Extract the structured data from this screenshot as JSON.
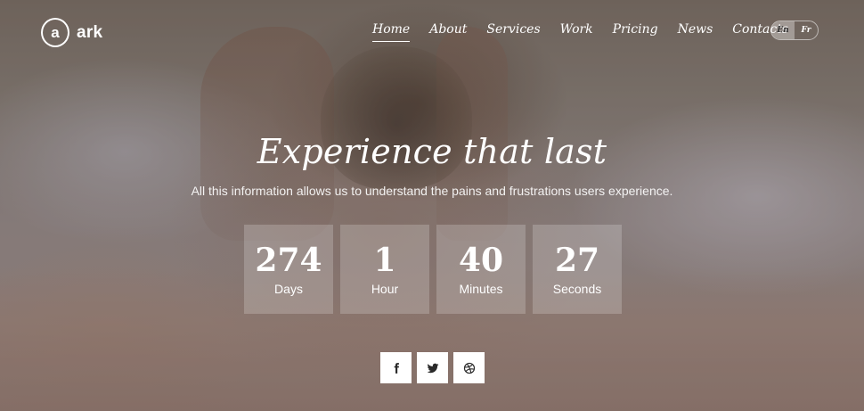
{
  "brand": {
    "mark": "a",
    "name": "ark"
  },
  "nav": {
    "items": [
      "Home",
      "About",
      "Services",
      "Work",
      "Pricing",
      "News",
      "Contacts"
    ],
    "active": "Home"
  },
  "lang": {
    "selected": "En",
    "other": "Fr"
  },
  "hero": {
    "title": "Experience that last",
    "subtitle": "All this information allows us to understand the pains and frustrations users experience."
  },
  "countdown": [
    {
      "value": "274",
      "label": "Days"
    },
    {
      "value": "1",
      "label": "Hour"
    },
    {
      "value": "40",
      "label": "Minutes"
    },
    {
      "value": "27",
      "label": "Seconds"
    }
  ],
  "social": [
    "facebook-icon",
    "twitter-icon",
    "dribbble-icon"
  ]
}
